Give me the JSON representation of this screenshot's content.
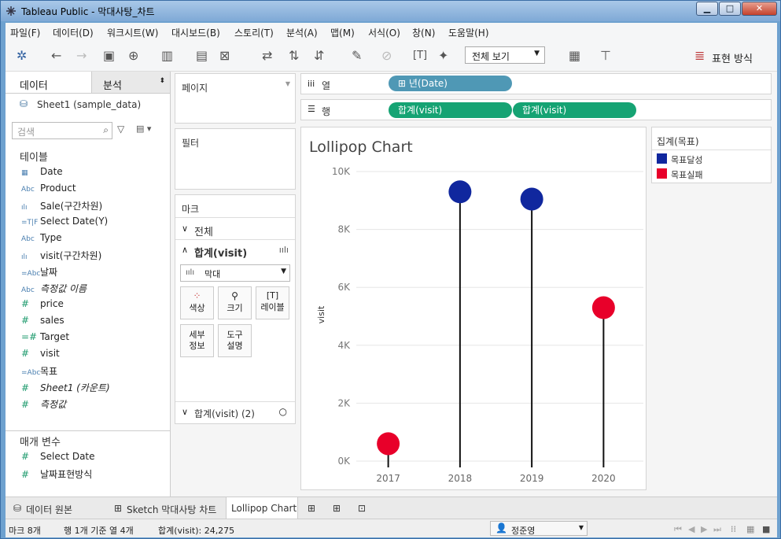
{
  "window": {
    "title": "Tableau Public - 막대사탕_차트"
  },
  "menu": [
    "파일(F)",
    "데이터(D)",
    "워크시트(W)",
    "대시보드(B)",
    "스토리(T)",
    "분석(A)",
    "맵(M)",
    "서식(O)",
    "창(N)",
    "도움말(H)"
  ],
  "toolbar": {
    "view_select": "전체 보기",
    "present_label": "표현 방식"
  },
  "sidebar": {
    "tab_data": "데이터",
    "tab_analysis": "분석",
    "datasource": "Sheet1 (sample_data)",
    "search_placeholder": "검색",
    "tables_header": "테이블",
    "fields": [
      {
        "type": "date",
        "icon": "▦",
        "name": "Date",
        "italic": false
      },
      {
        "type": "abc",
        "icon": "Abc",
        "name": "Product",
        "italic": false
      },
      {
        "type": "bin",
        "icon": "ılı",
        "name": "Sale(구간차원)",
        "italic": false
      },
      {
        "type": "tf",
        "icon": "=T|F",
        "name": "Select Date(Y)",
        "italic": false
      },
      {
        "type": "abc",
        "icon": "Abc",
        "name": "Type",
        "italic": false
      },
      {
        "type": "bin",
        "icon": "ılı",
        "name": "visit(구간차원)",
        "italic": false
      },
      {
        "type": "abc",
        "icon": "=Abc",
        "name": "날짜",
        "italic": false
      },
      {
        "type": "abc",
        "icon": "Abc",
        "name": "측정값 이름",
        "italic": true
      },
      {
        "type": "measure",
        "icon": "#",
        "name": "price",
        "italic": false
      },
      {
        "type": "measure",
        "icon": "#",
        "name": "sales",
        "italic": false
      },
      {
        "type": "measure",
        "icon": "=#",
        "name": "Target",
        "italic": false
      },
      {
        "type": "measure",
        "icon": "#",
        "name": "visit",
        "italic": false
      },
      {
        "type": "abc",
        "icon": "=Abc",
        "name": "목표",
        "italic": false
      },
      {
        "type": "measure",
        "icon": "#",
        "name": "Sheet1 (카운트)",
        "italic": true
      },
      {
        "type": "measure",
        "icon": "#",
        "name": "측정값",
        "italic": true
      }
    ],
    "params_header": "매개 변수",
    "params": [
      {
        "icon": "#",
        "name": "Select Date"
      },
      {
        "icon": "#",
        "name": "날짜표현방식"
      }
    ]
  },
  "cards": {
    "pages": "페이지",
    "filters": "필터",
    "marks": "마크",
    "all": "전체",
    "sum1": "합계(visit)",
    "marktype": "막대",
    "btn_color": "색상",
    "btn_size": "크기",
    "btn_label": "레이블",
    "btn_detail": "세부\n정보",
    "btn_tooltip": "도구\n설명",
    "sum2": "합계(visit) (2)"
  },
  "shelves": {
    "columns": "열",
    "rows": "행",
    "col_pill": "년(Date)",
    "row_pill1": "합계(visit)",
    "row_pill2": "합계(visit)"
  },
  "legend": {
    "title": "집계(목표)",
    "items": [
      {
        "label": "목표달성",
        "color": "#10279e"
      },
      {
        "label": "목표실패",
        "color": "#e8002a"
      }
    ]
  },
  "chart_data": {
    "type": "scatter",
    "title": "Lollipop Chart",
    "ylabel": "visit",
    "categories": [
      "2017",
      "2018",
      "2019",
      "2020"
    ],
    "values": [
      600,
      9300,
      9050,
      5300
    ],
    "colors": [
      "#e8002a",
      "#10279e",
      "#10279e",
      "#e8002a"
    ],
    "yticks": [
      "0K",
      "2K",
      "4K",
      "6K",
      "8K",
      "10K"
    ],
    "ylim": [
      0,
      10000
    ],
    "grid": true
  },
  "tabs": {
    "source": "데이터 원본",
    "sheet1": "Sketch 막대사탕 차트",
    "sheet2": "Lollipop Chart"
  },
  "status": {
    "marks": "마크 8개",
    "rows": "행 1개 기준 열 4개",
    "sum": "합계(visit): 24,275",
    "user": "정준영"
  }
}
